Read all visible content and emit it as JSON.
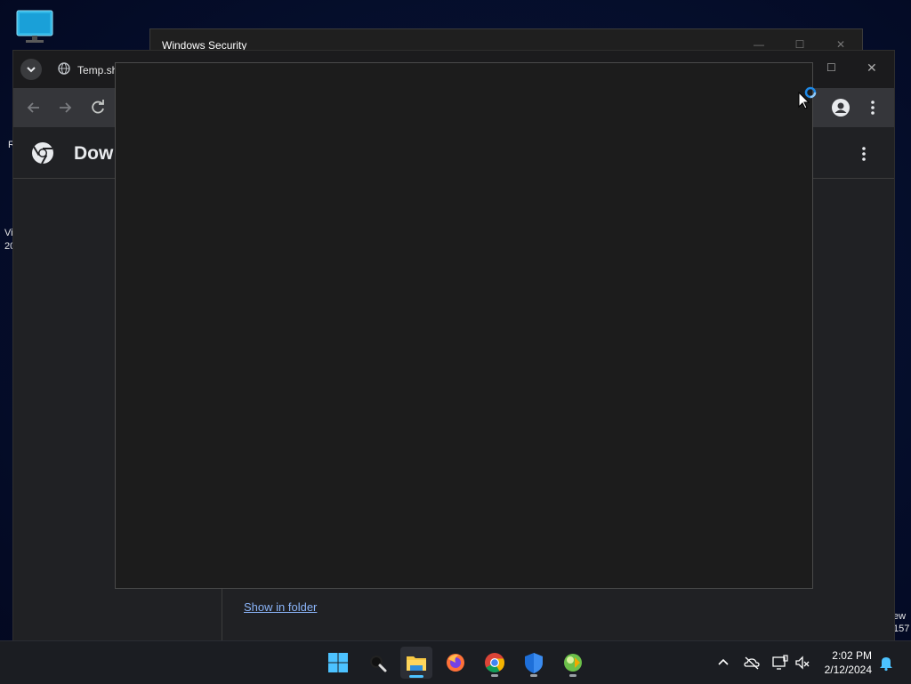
{
  "desktop": {
    "fragments": [
      "R",
      "Vi",
      "20",
      "ew",
      "157"
    ]
  },
  "security_window": {
    "title": "Windows Security"
  },
  "chrome": {
    "tab_title": "Temp.sh",
    "page_title": "Dow",
    "show_in_folder_label": "Show in folder"
  },
  "taskbar": {
    "apps": [
      "start",
      "search",
      "file-explorer",
      "firefox",
      "chrome",
      "windows-security",
      "other-app"
    ],
    "time": "2:02 PM",
    "date": "2/12/2024"
  },
  "colors": {
    "accent": "#4cc2ff",
    "link": "#8ab4f8",
    "overlay_bg": "#1c1c1c"
  }
}
